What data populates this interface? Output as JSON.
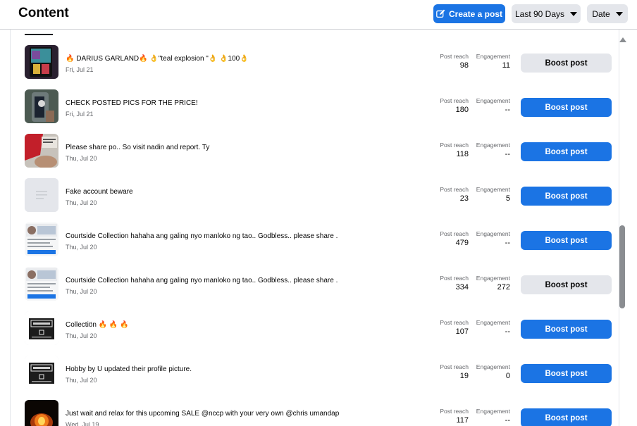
{
  "header": {
    "title": "Content",
    "create_label": "Create a post",
    "range_label": "Last 90 Days",
    "sort_label": "Date"
  },
  "labels": {
    "reach": "Post reach",
    "engagement": "Engagement"
  },
  "posts": [
    {
      "title": "🔥 DARIUS GARLAND🔥 👌\"teal explosion \"👌 👌100👌",
      "date": "Fri, Jul 21",
      "reach": "98",
      "engagement": "11",
      "boost": "Boost post",
      "boost_style": "gray",
      "thumb": "cards"
    },
    {
      "title": "CHECK POSTED PICS FOR THE PRICE!",
      "date": "Fri, Jul 21",
      "reach": "180",
      "engagement": "--",
      "boost": "Boost post",
      "boost_style": "blue",
      "thumb": "photo-dark"
    },
    {
      "title": "Please share po.. So visit nadin and report. Ty",
      "date": "Thu, Jul 20",
      "reach": "118",
      "engagement": "--",
      "boost": "Boost post",
      "boost_style": "blue",
      "thumb": "photo-red"
    },
    {
      "title": "Fake account beware",
      "date": "Thu, Jul 20",
      "reach": "23",
      "engagement": "5",
      "boost": "Boost post",
      "boost_style": "blue",
      "thumb": "text"
    },
    {
      "title": "Courtside Collection hahaha ang galing nyo manloko ng tao.. Godbless.. please share .",
      "date": "Thu, Jul 20",
      "reach": "479",
      "engagement": "--",
      "boost": "Boost post",
      "boost_style": "blue",
      "thumb": "screenshot"
    },
    {
      "title": "Courtside Collection hahaha ang galing nyo manloko ng tao.. Godbless.. please share .",
      "date": "Thu, Jul 20",
      "reach": "334",
      "engagement": "272",
      "boost": "Boost post",
      "boost_style": "gray",
      "thumb": "screenshot"
    },
    {
      "title": "Collectiön 🔥 🔥 🔥",
      "date": "Thu, Jul 20",
      "reach": "107",
      "engagement": "--",
      "boost": "Boost post",
      "boost_style": "blue",
      "thumb": "logo"
    },
    {
      "title": "Hobby by U updated their profile picture.",
      "date": "Thu, Jul 20",
      "reach": "19",
      "engagement": "0",
      "boost": "Boost post",
      "boost_style": "blue",
      "thumb": "logo"
    },
    {
      "title": "Just wait and relax for this upcoming SALE @nccp with your very own @chris umandap",
      "date": "Wed, Jul 19",
      "reach": "117",
      "engagement": "--",
      "boost": "Boost post",
      "boost_style": "blue",
      "thumb": "fire"
    }
  ],
  "colors": {
    "accent": "#1b74e4",
    "secondary": "#e4e6eb"
  }
}
